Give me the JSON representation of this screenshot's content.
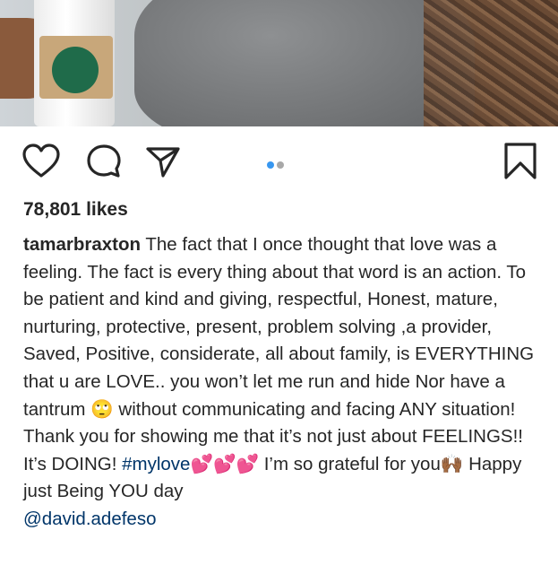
{
  "post": {
    "likes": "78,801 likes",
    "username": "tamarbraxton",
    "caption_part1": " The fact that I once thought that love was a feeling. The fact is every thing about that word is an action. To be patient and kind and giving, respectful, Honest, mature, nurturing, protective, present, problem solving ,a provider, Saved, Positive, considerate, all about family, is EVERYTHING that u are LOVE.. you won’t let me run and hide Nor have a tantrum ",
    "emoji_eyeroll": "🙄",
    "caption_part2": " without communicating and  facing ANY situation! Thank you for showing me that it’s not just about FEELINGS!! It’s DOING!  ",
    "hashtag": "#mylove",
    "emoji_hearts": "💕💕💕",
    "caption_part3": " I’m so grateful for you",
    "emoji_hands": "🙌🏾",
    "caption_part4": " Happy just Being YOU day",
    "mention": "@david.adefeso"
  },
  "carousel": {
    "total": 2,
    "active_index": 0
  },
  "icons": [
    "heart-icon",
    "comment-icon",
    "share-icon",
    "bookmark-icon"
  ],
  "colors": {
    "link": "#003569",
    "active_dot": "#3897f0",
    "text": "#262626"
  }
}
